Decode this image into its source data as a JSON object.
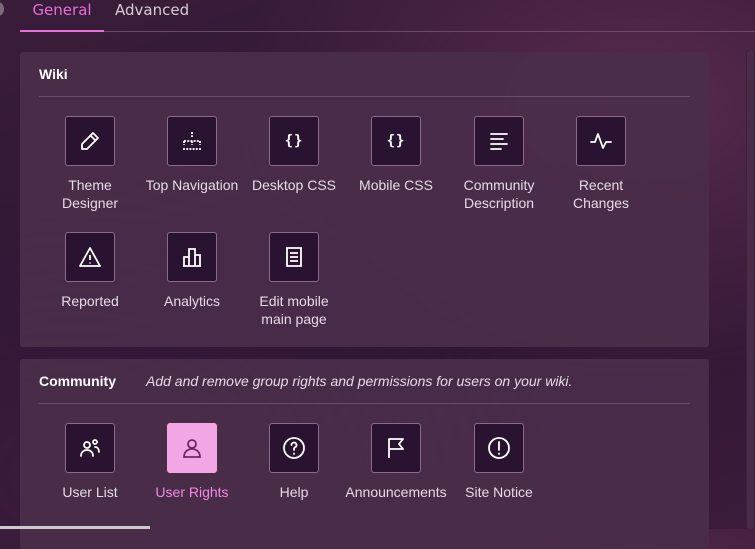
{
  "tabs": [
    {
      "label": "General"
    },
    {
      "label": "Advanced"
    }
  ],
  "wiki": {
    "title": "Wiki",
    "tiles": [
      {
        "label": "Theme Designer",
        "icon": "pencil-icon"
      },
      {
        "label": "Top Navigation",
        "icon": "sitemap-icon"
      },
      {
        "label": "Desktop CSS",
        "icon": "code-braces-icon",
        "glyph": "{}"
      },
      {
        "label": "Mobile CSS",
        "icon": "code-braces-icon",
        "glyph": "{}"
      },
      {
        "label": "Community Description",
        "icon": "text-lines-icon"
      },
      {
        "label": "Recent Changes",
        "icon": "activity-icon"
      },
      {
        "label": "Reported",
        "icon": "warning-icon"
      },
      {
        "label": "Analytics",
        "icon": "bar-chart-icon"
      },
      {
        "label": "Edit mobile main page",
        "icon": "page-icon"
      }
    ]
  },
  "community": {
    "title": "Community",
    "description": "Add and remove group rights and permissions for users on your wiki.",
    "tiles": [
      {
        "label": "User List",
        "icon": "users-icon"
      },
      {
        "label": "User Rights",
        "icon": "user-icon",
        "active": true
      },
      {
        "label": "Help",
        "icon": "question-icon"
      },
      {
        "label": "Announcements",
        "icon": "flag-icon"
      },
      {
        "label": "Site Notice",
        "icon": "exclamation-icon"
      }
    ]
  },
  "colors": {
    "accent": "#e46fd6",
    "panel": "#4a2e4a",
    "tile_bg": "#2a1330"
  }
}
